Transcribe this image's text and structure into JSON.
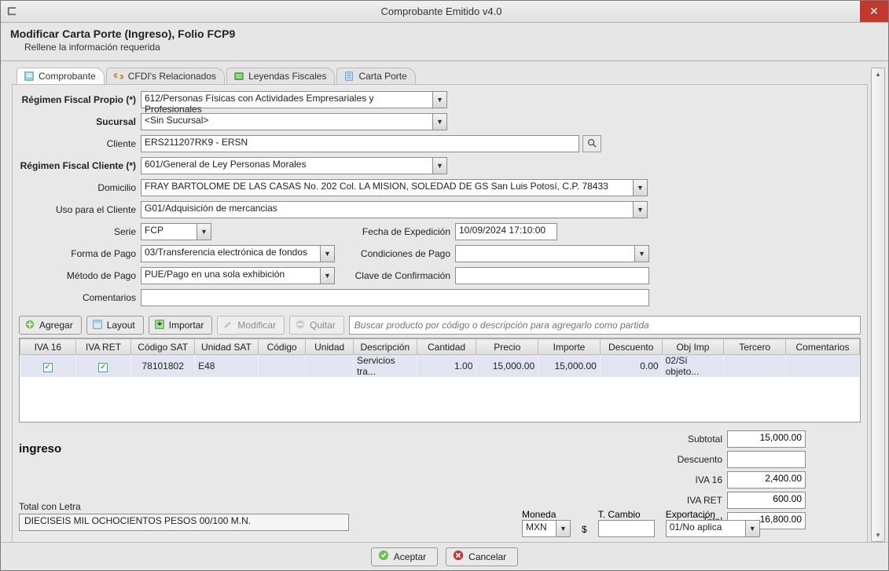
{
  "window": {
    "title": "Comprobante Emitido v4.0"
  },
  "header": {
    "title": "Modificar Carta Porte (Ingreso), Folio FCP9",
    "subtitle": "Rellene la información requerida"
  },
  "tabs": [
    {
      "label": "Comprobante"
    },
    {
      "label": "CFDI's Relacionados"
    },
    {
      "label": "Leyendas Fiscales"
    },
    {
      "label": "Carta Porte"
    }
  ],
  "labels": {
    "regimen_propio": "Régimen Fiscal Propio (*)",
    "sucursal": "Sucursal",
    "cliente": "Cliente",
    "regimen_cliente": "Régimen Fiscal Cliente (*)",
    "domicilio": "Domicilio",
    "uso_cliente": "Uso para el Cliente",
    "serie": "Serie",
    "fecha_exp": "Fecha de Expedición",
    "forma_pago": "Forma de Pago",
    "cond_pago": "Condiciones de Pago",
    "metodo_pago": "Método de Pago",
    "clave_conf": "Clave de Confirmación",
    "comentarios": "Comentarios"
  },
  "form": {
    "regimen_propio": "612/Personas Físicas con Actividades Empresariales y Profesionales",
    "sucursal": "<Sin Sucursal>",
    "cliente": "ERS211207RK9 - ERSN",
    "regimen_cliente": "601/General de Ley Personas Morales",
    "domicilio": "FRAY BARTOLOME DE LAS CASAS No. 202 Col. LA MISION, SOLEDAD DE GS San Luis Potosí, C.P. 78433",
    "uso_cliente": "G01/Adquisición de mercancias",
    "serie": "FCP",
    "fecha_exp": "10/09/2024 17:10:00",
    "forma_pago": "03/Transferencia electrónica de fondos",
    "cond_pago": "",
    "metodo_pago": "PUE/Pago en una sola exhibición",
    "clave_conf": "",
    "comentarios": ""
  },
  "toolbar": {
    "agregar": "Agregar",
    "layout": "Layout",
    "importar": "Importar",
    "modificar": "Modificar",
    "quitar": "Quitar",
    "search_placeholder": "Buscar producto por código o descripción para agregarlo como partida"
  },
  "grid": {
    "columns": [
      "IVA 16",
      "IVA RET",
      "Código SAT",
      "Unidad SAT",
      "Código",
      "Unidad",
      "Descripción",
      "Cantidad",
      "Precio",
      "Importe",
      "Descuento",
      "Obj Imp",
      "Tercero",
      "Comentarios"
    ],
    "rows": [
      {
        "iva16": true,
        "ivaret": true,
        "codigo_sat": "78101802",
        "unidad_sat": "E48",
        "codigo": "",
        "unidad": "",
        "descripcion": "Servicios tra...",
        "cantidad": "1.00",
        "precio": "15,000.00",
        "importe": "15,000.00",
        "descuento": "0.00",
        "obj_imp": "02/Sí objeto...",
        "tercero": "",
        "comentarios": ""
      }
    ]
  },
  "totals": {
    "ingreso_label": "ingreso",
    "labels": {
      "subtotal": "Subtotal",
      "descuento": "Descuento",
      "iva16": "IVA 16",
      "ivaret": "IVA RET",
      "total": "Total",
      "moneda": "Moneda",
      "tcambio": "T. Cambio",
      "exportacion": "Exportación",
      "total_con_letra": "Total con Letra"
    },
    "subtotal": "15,000.00",
    "descuento": "",
    "iva16": "2,400.00",
    "ivaret": "600.00",
    "total": "16,800.00",
    "moneda": "MXN",
    "dollar": "$",
    "tcambio": "",
    "exportacion": "01/No aplica",
    "total_con_letra": "DIECISEIS MIL OCHOCIENTOS PESOS 00/100 M.N."
  },
  "footer": {
    "aceptar": "Aceptar",
    "cancelar": "Cancelar"
  }
}
